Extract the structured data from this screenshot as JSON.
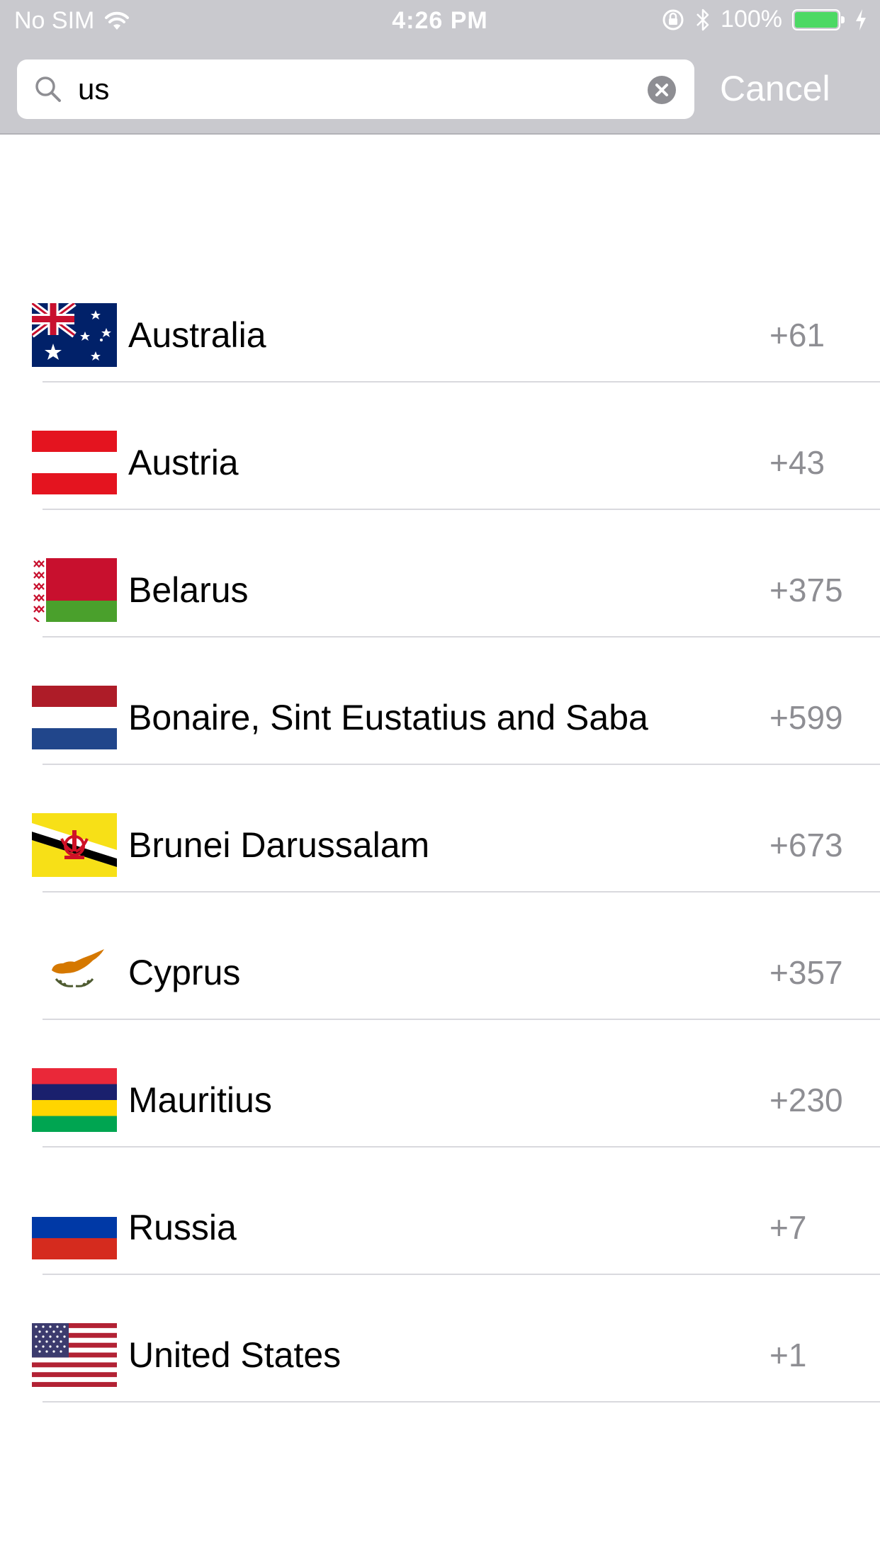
{
  "status_bar": {
    "carrier": "No SIM",
    "time": "4:26 PM",
    "battery": "100%",
    "battery_level": 1.0,
    "battery_color": "#4cd964",
    "icons": [
      "wifi-icon",
      "rotation-lock-icon",
      "bluetooth-icon",
      "battery-icon",
      "charging-icon"
    ]
  },
  "search": {
    "value": "us",
    "icon": "search-icon",
    "clear_icon": "clear-icon",
    "cancel_label": "Cancel"
  },
  "countries": [
    {
      "name": "Australia",
      "code": "+61",
      "flag": "australia-flag-icon"
    },
    {
      "name": "Austria",
      "code": "+43",
      "flag": "austria-flag-icon"
    },
    {
      "name": "Belarus",
      "code": "+375",
      "flag": "belarus-flag-icon"
    },
    {
      "name": "Bonaire, Sint Eustatius and Saba",
      "code": "+599",
      "flag": "bonaire-flag-icon"
    },
    {
      "name": "Brunei Darussalam",
      "code": "+673",
      "flag": "brunei-flag-icon"
    },
    {
      "name": "Cyprus",
      "code": "+357",
      "flag": "cyprus-flag-icon"
    },
    {
      "name": "Mauritius",
      "code": "+230",
      "flag": "mauritius-flag-icon"
    },
    {
      "name": "Russia",
      "code": "+7",
      "flag": "russia-flag-icon"
    },
    {
      "name": "United States",
      "code": "+1",
      "flag": "united-states-flag-icon"
    }
  ],
  "colors": {
    "bar_background": "#c9c9ce",
    "code_text": "#8e8e93",
    "separator": "#d9d9de"
  }
}
